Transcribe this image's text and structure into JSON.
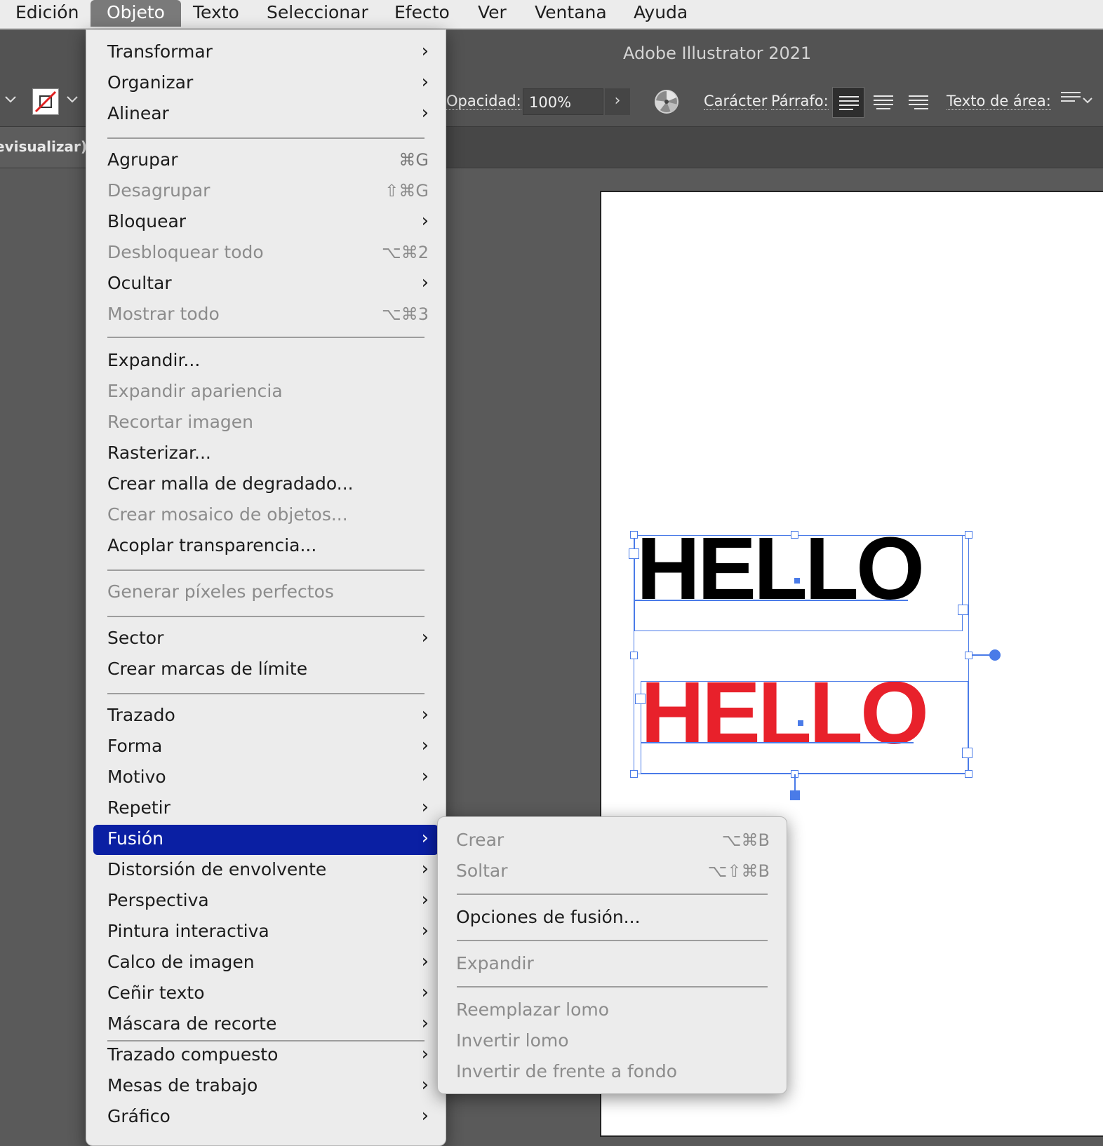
{
  "menubar": {
    "items": [
      "Edición",
      "Objeto",
      "Texto",
      "Seleccionar",
      "Efecto",
      "Ver",
      "Ventana",
      "Ayuda"
    ]
  },
  "window": {
    "title": "Adobe Illustrator 2021"
  },
  "controlbar": {
    "opacity_label": "Opacidad:",
    "opacity_value": "100%",
    "character_label": "Carácter",
    "paragraph_label": "Párrafo:",
    "area_type_label": "Texto de área:"
  },
  "document_tab": {
    "title_fragment": "revisualizar)"
  },
  "canvas": {
    "text1": "HELLO",
    "text1_color": "#000000",
    "text2": "HELLO",
    "text2_color": "#e8212b",
    "selection_color": "#4a7be8"
  },
  "object_menu": {
    "items": [
      {
        "label": "Transformar",
        "submenu": true
      },
      {
        "label": "Organizar",
        "submenu": true
      },
      {
        "label": "Alinear",
        "submenu": true
      },
      {
        "label": "Agrupar",
        "shortcut": "⌘G"
      },
      {
        "label": "Desagrupar",
        "shortcut": "⇧⌘G",
        "disabled": true
      },
      {
        "label": "Bloquear",
        "submenu": true
      },
      {
        "label": "Desbloquear todo",
        "shortcut": "⌥⌘2",
        "disabled": true
      },
      {
        "label": "Ocultar",
        "submenu": true
      },
      {
        "label": "Mostrar todo",
        "shortcut": "⌥⌘3",
        "disabled": true
      },
      {
        "label": "Expandir..."
      },
      {
        "label": "Expandir apariencia",
        "disabled": true
      },
      {
        "label": "Recortar imagen",
        "disabled": true
      },
      {
        "label": "Rasterizar..."
      },
      {
        "label": "Crear malla de degradado..."
      },
      {
        "label": "Crear mosaico de objetos...",
        "disabled": true
      },
      {
        "label": "Acoplar transparencia..."
      },
      {
        "label": "Generar píxeles perfectos",
        "disabled": true
      },
      {
        "label": "Sector",
        "submenu": true
      },
      {
        "label": "Crear marcas de límite"
      },
      {
        "label": "Trazado",
        "submenu": true
      },
      {
        "label": "Forma",
        "submenu": true
      },
      {
        "label": "Motivo",
        "submenu": true
      },
      {
        "label": "Repetir",
        "submenu": true
      },
      {
        "label": "Fusión",
        "submenu": true,
        "highlighted": true
      },
      {
        "label": "Distorsión de envolvente",
        "submenu": true
      },
      {
        "label": "Perspectiva",
        "submenu": true
      },
      {
        "label": "Pintura interactiva",
        "submenu": true
      },
      {
        "label": "Calco de imagen",
        "submenu": true
      },
      {
        "label": "Ceñir texto",
        "submenu": true
      },
      {
        "label": "Máscara de recorte",
        "submenu": true
      },
      {
        "label": "Trazado compuesto",
        "submenu": true
      },
      {
        "label": "Mesas de trabajo",
        "submenu": true
      },
      {
        "label": "Gráfico",
        "submenu": true
      }
    ]
  },
  "blend_submenu": {
    "items": [
      {
        "label": "Crear",
        "shortcut": "⌥⌘B",
        "disabled": true
      },
      {
        "label": "Soltar",
        "shortcut": "⌥⇧⌘B",
        "disabled": true
      },
      {
        "label": "Opciones de fusión..."
      },
      {
        "label": "Expandir",
        "disabled": true
      },
      {
        "label": "Reemplazar lomo",
        "disabled": true
      },
      {
        "label": "Invertir lomo",
        "disabled": true
      },
      {
        "label": "Invertir de frente a fondo",
        "disabled": true
      }
    ]
  },
  "colors": {
    "highlight": "#0a1fa3",
    "menu_bg": "#ececec",
    "workspace": "#5a5a5a"
  }
}
